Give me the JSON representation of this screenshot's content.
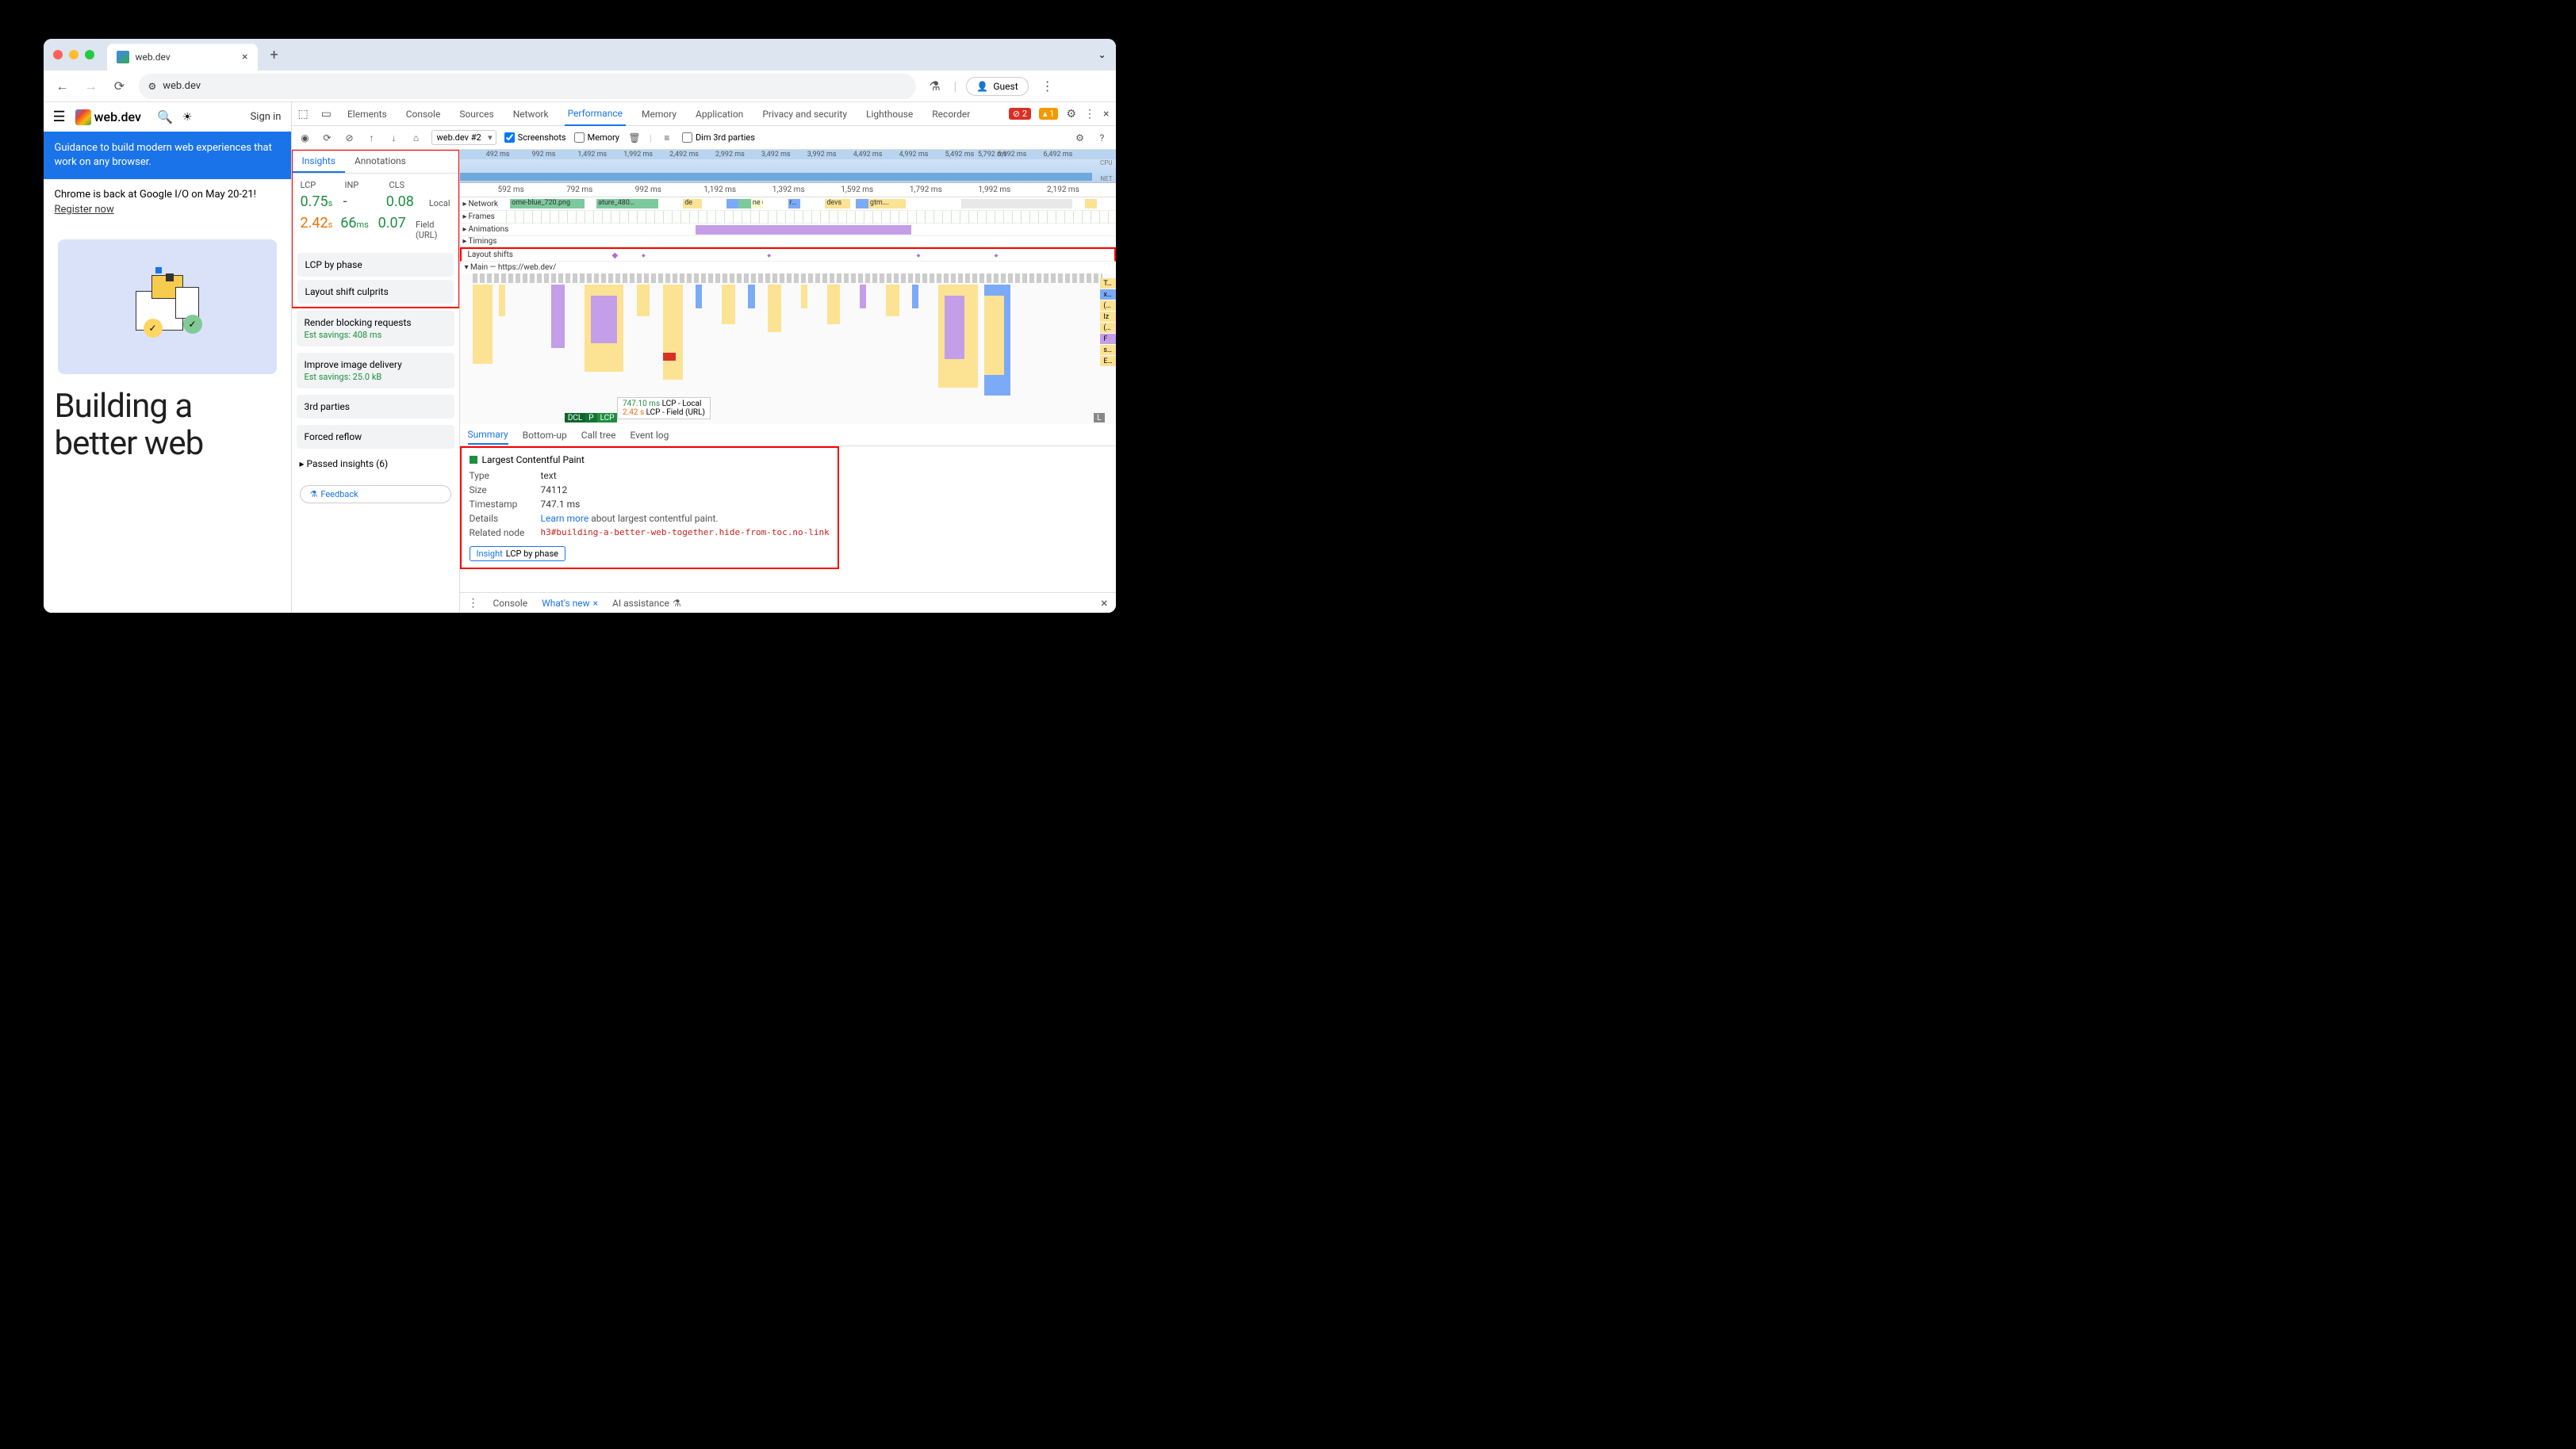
{
  "browser": {
    "tab_title": "web.dev",
    "url": "web.dev",
    "guest": "Guest"
  },
  "page": {
    "logo": "web.dev",
    "signin": "Sign in",
    "banner": "Guidance to build modern web experiences that work on any browser.",
    "io_text": "Chrome is back at Google I/O on May 20-21!",
    "io_link": "Register now",
    "hero": "Building a better web"
  },
  "devtools": {
    "tabs": [
      "Elements",
      "Console",
      "Sources",
      "Network",
      "Performance",
      "Memory",
      "Application",
      "Privacy and security",
      "Lighthouse",
      "Recorder"
    ],
    "errors": "2",
    "warnings": "1",
    "recording_target": "web.dev #2",
    "screenshots_label": "Screenshots",
    "memory_label": "Memory",
    "dim_label": "Dim 3rd parties",
    "overview_ticks": [
      "492 ms",
      "992 ms",
      "1,492 ms",
      "1,992 ms",
      "2,492 ms",
      "2,992 ms",
      "3,492 ms",
      "3,992 ms",
      "4,492 ms",
      "4,992 ms",
      "5,492 ms",
      "5,792 ms",
      "5,992 ms",
      "6,492 ms"
    ],
    "timeline_ticks": [
      "592 ms",
      "792 ms",
      "992 ms",
      "1,192 ms",
      "1,392 ms",
      "1,592 ms",
      "1,792 ms",
      "1,992 ms",
      "2,192 ms"
    ],
    "tracks": {
      "network": "Network",
      "frames": "Frames",
      "animations": "Animations",
      "timings": "Timings",
      "layout_shifts": "Layout shifts",
      "main": "Main — https://web.dev/"
    },
    "network_items": [
      "ome-blue_720.png",
      "ature_480…",
      "de",
      "ne (w",
      "r…",
      "devs",
      "gtm…."
    ],
    "flame_right": [
      "T…",
      "x…",
      "(…",
      "Iz",
      "(…",
      "F",
      "s…",
      "E…"
    ],
    "lcp_callout": {
      "local_time": "747.10 ms",
      "local_label": "LCP - Local",
      "field_time": "2.42 s",
      "field_label": "LCP - Field (URL)"
    },
    "markers": {
      "dcl": "DCL",
      "p": "P",
      "lcp": "LCP",
      "l": "L"
    }
  },
  "insights": {
    "tabs": [
      "Insights",
      "Annotations"
    ],
    "headers": {
      "lcp": "LCP",
      "inp": "INP",
      "cls": "CLS"
    },
    "local": {
      "lcp": "0.75",
      "lcp_unit": "s",
      "inp": "-",
      "cls": "0.08",
      "label": "Local"
    },
    "field": {
      "lcp": "2.42",
      "lcp_unit": "s",
      "inp": "66",
      "inp_unit": "ms",
      "cls": "0.07",
      "label": "Field (URL)"
    },
    "cards": {
      "lcp_phase": "LCP by phase",
      "layout_culprits": "Layout shift culprits",
      "render_blocking": "Render blocking requests",
      "render_savings": "Est savings: 408 ms",
      "image_delivery": "Improve image delivery",
      "image_savings": "Est savings: 25.0 kB",
      "third_parties": "3rd parties",
      "forced_reflow": "Forced reflow"
    },
    "passed": "Passed insights (6)",
    "feedback": "Feedback"
  },
  "details": {
    "tabs": [
      "Summary",
      "Bottom-up",
      "Call tree",
      "Event log"
    ],
    "title": "Largest Contentful Paint",
    "type_key": "Type",
    "type_val": "text",
    "size_key": "Size",
    "size_val": "74112",
    "ts_key": "Timestamp",
    "ts_val": "747.1 ms",
    "details_key": "Details",
    "learn_more": "Learn more",
    "details_rest": "about largest contentful paint.",
    "node_key": "Related node",
    "node_val": "h3#building-a-better-web-together.hide-from-toc.no-link",
    "insight_prefix": "Insight",
    "insight_label": "LCP by phase"
  },
  "drawer": {
    "console": "Console",
    "whatsnew": "What's new",
    "ai": "AI assistance"
  }
}
